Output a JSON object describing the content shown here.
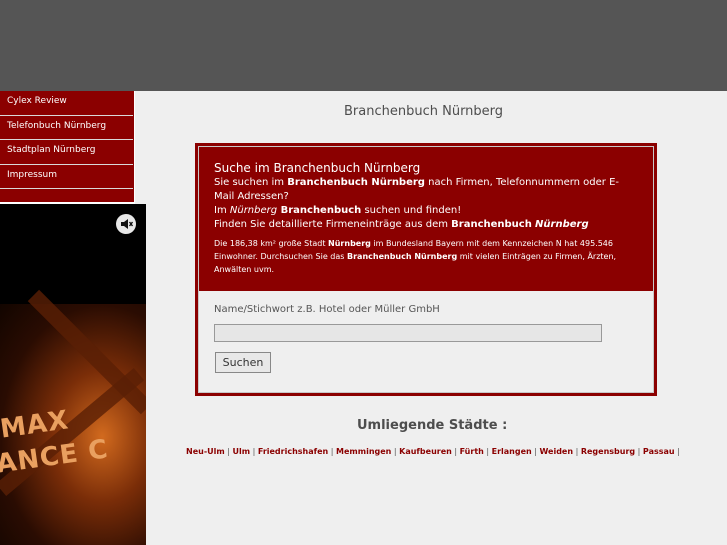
{
  "sidebar": {
    "items": [
      {
        "label": "Cylex Review"
      },
      {
        "label": "Telefonbuch Nürnberg"
      },
      {
        "label": "Stadtplan Nürnberg"
      },
      {
        "label": "Impressum"
      }
    ]
  },
  "media": {
    "mute_icon": "speaker-mute-icon",
    "art_text_line1": "MAX",
    "art_text_line2": "ANCE C"
  },
  "page": {
    "title": "Branchenbuch Nürnberg"
  },
  "search": {
    "heading": "Suche im Branchenbuch Nürnberg",
    "intro_1a": "Sie suchen im ",
    "intro_1b": "Branchenbuch Nürnberg",
    "intro_1c": " nach Firmen, Telefonnummern oder E-Mail Adressen?",
    "intro_2a": "Im ",
    "intro_2b": "Nürnberg",
    "intro_2c": " Branchenbuch",
    "intro_2d": " suchen und finden!",
    "intro_3a": "Finden Sie detaillierte Firmeneinträge aus dem ",
    "intro_3b": "Branchenbuch",
    "intro_3c": "Nürnberg",
    "small_a": "Die 186,38 km² große Stadt ",
    "small_b": "Nürnberg",
    "small_c": " im Bundesland Bayern mit dem Kennzeichen N hat 495.546 Einwohner. Durchsuchen Sie das ",
    "small_d": "Branchenbuch Nürnberg",
    "small_e": " mit vielen Einträgen zu Firmen, Ärzten, Anwälten uvm.",
    "field_label": "Name/Stichwort z.B. Hotel oder Müller GmbH",
    "field_value": "",
    "button_label": "Suchen"
  },
  "cities": {
    "title": "Umliegende Städte :",
    "links": [
      "Neu-Ulm",
      "Ulm",
      "Friedrichshafen",
      "Memmingen",
      "Kaufbeuren",
      "Fürth",
      "Erlangen",
      "Weiden",
      "Regensburg",
      "Passau"
    ],
    "separator": "|"
  },
  "colors": {
    "accent": "#8b0000",
    "topbar": "#555555",
    "background": "#efefef"
  }
}
